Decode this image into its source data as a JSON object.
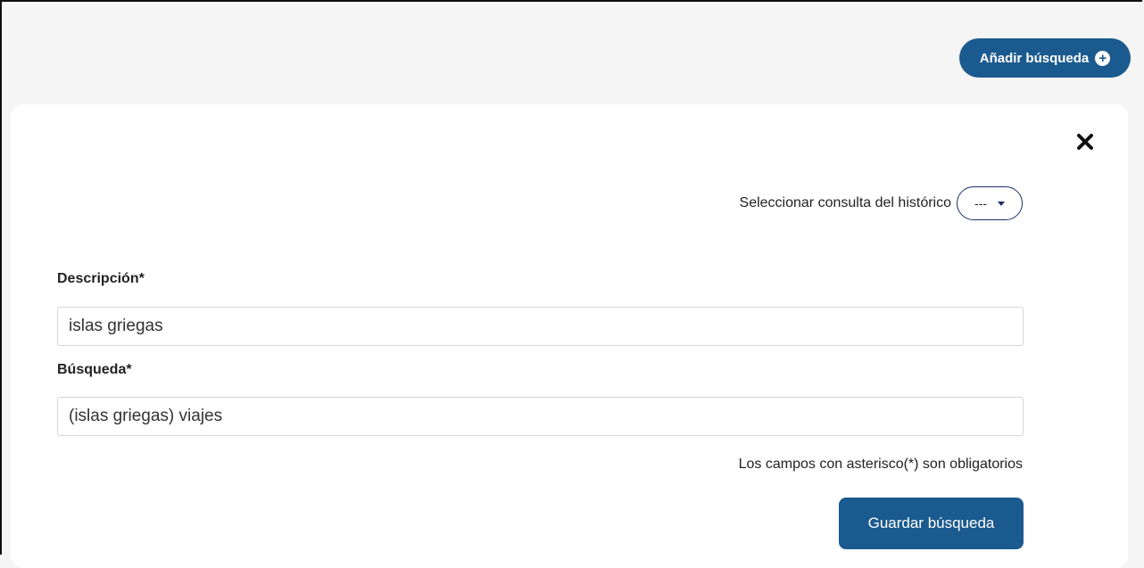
{
  "header": {
    "add_search_label": "Añadir búsqueda",
    "add_search_icon": "plus-circle-icon"
  },
  "panel": {
    "close_icon": "close-icon",
    "history": {
      "label": "Seleccionar consulta del histórico",
      "selected": "---"
    },
    "description": {
      "label": "Descripción*",
      "value": "islas griegas"
    },
    "search": {
      "label": "Búsqueda*",
      "value": "(islas griegas) viajes"
    },
    "required_note": "Los campos con asterisco(*) son obligatorios",
    "save_label": "Guardar búsqueda"
  },
  "colors": {
    "accent": "#1b5a8e",
    "background": "#f5f5f5",
    "panel": "#ffffff"
  }
}
